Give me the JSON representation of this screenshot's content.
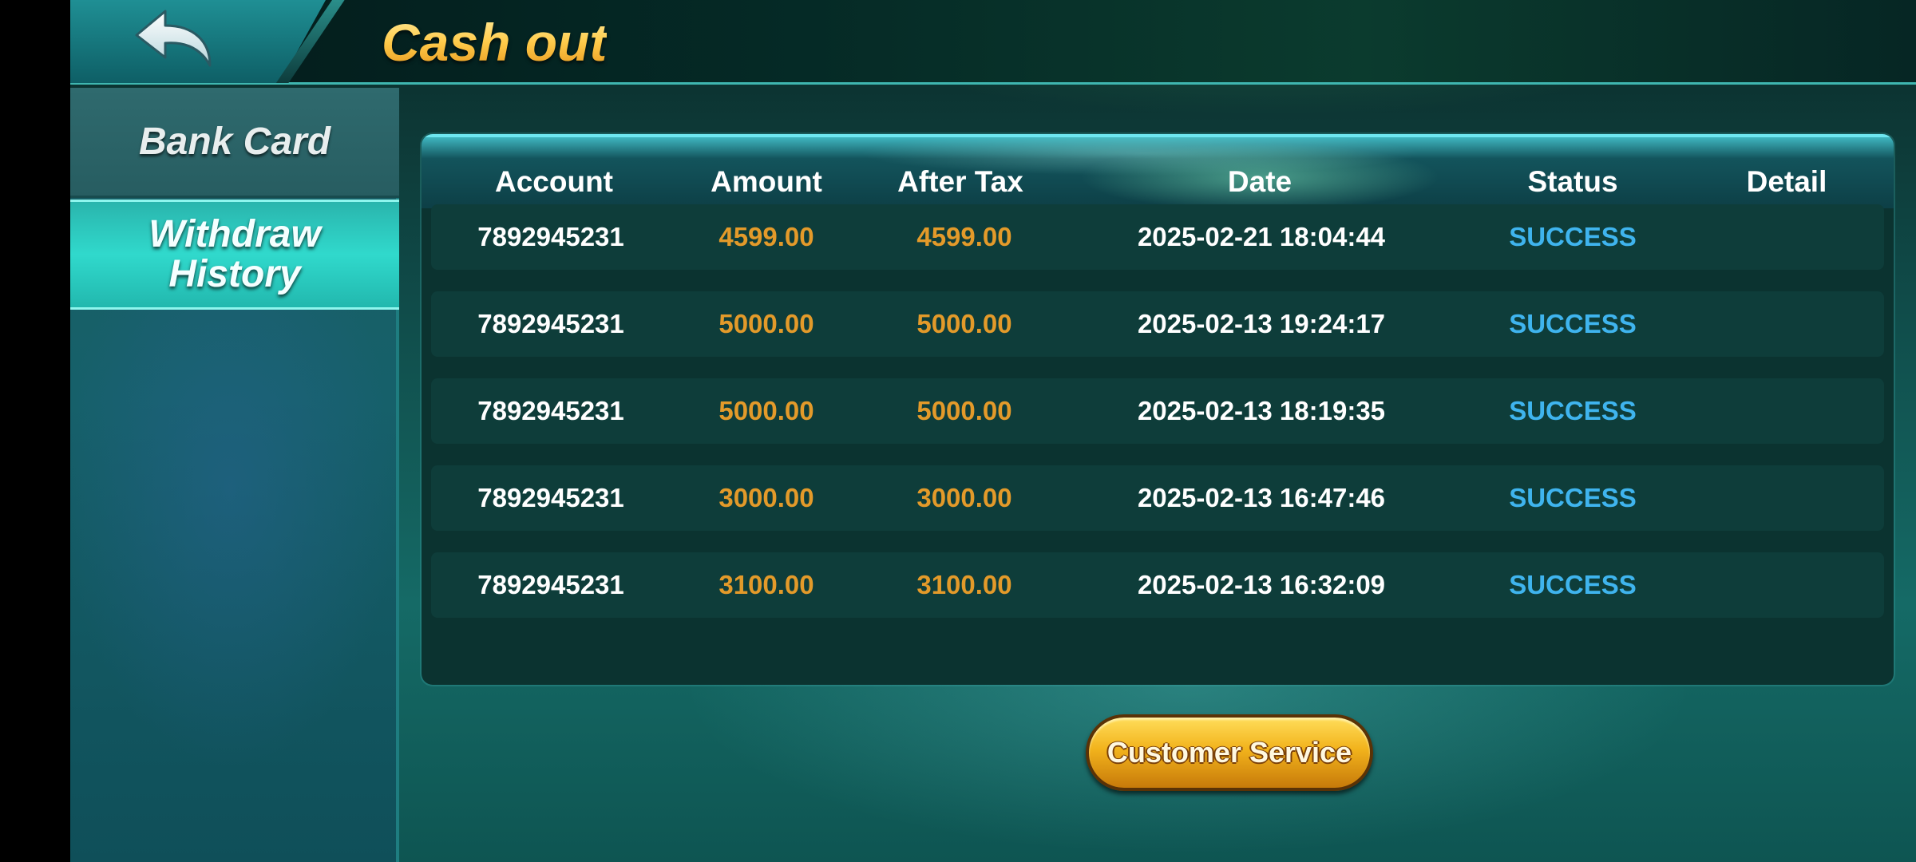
{
  "header": {
    "title": "Cash out",
    "back_icon": "back-arrow-icon"
  },
  "sidebar": {
    "items": [
      {
        "label": "Bank Card",
        "active": false
      },
      {
        "label_line1": "Withdraw",
        "label_line2": "History",
        "active": true
      }
    ]
  },
  "table": {
    "columns": [
      "Account",
      "Amount",
      "After Tax",
      "Date",
      "Status",
      "Detail"
    ],
    "rows": [
      {
        "account": "7892945231",
        "amount": "4599.00",
        "after_tax": "4599.00",
        "date": "2025-02-21 18:04:44",
        "status": "SUCCESS"
      },
      {
        "account": "7892945231",
        "amount": "5000.00",
        "after_tax": "5000.00",
        "date": "2025-02-13 19:24:17",
        "status": "SUCCESS"
      },
      {
        "account": "7892945231",
        "amount": "5000.00",
        "after_tax": "5000.00",
        "date": "2025-02-13 18:19:35",
        "status": "SUCCESS"
      },
      {
        "account": "7892945231",
        "amount": "3000.00",
        "after_tax": "3000.00",
        "date": "2025-02-13 16:47:46",
        "status": "SUCCESS"
      },
      {
        "account": "7892945231",
        "amount": "3100.00",
        "after_tax": "3100.00",
        "date": "2025-02-13 16:32:09",
        "status": "SUCCESS"
      }
    ]
  },
  "footer": {
    "customer_service_label": "Customer Service"
  },
  "colors": {
    "amount": "#e39a2a",
    "status_success": "#3fb4ee",
    "title_gold": "#ffc54a",
    "accent_teal": "#30d9cc"
  }
}
